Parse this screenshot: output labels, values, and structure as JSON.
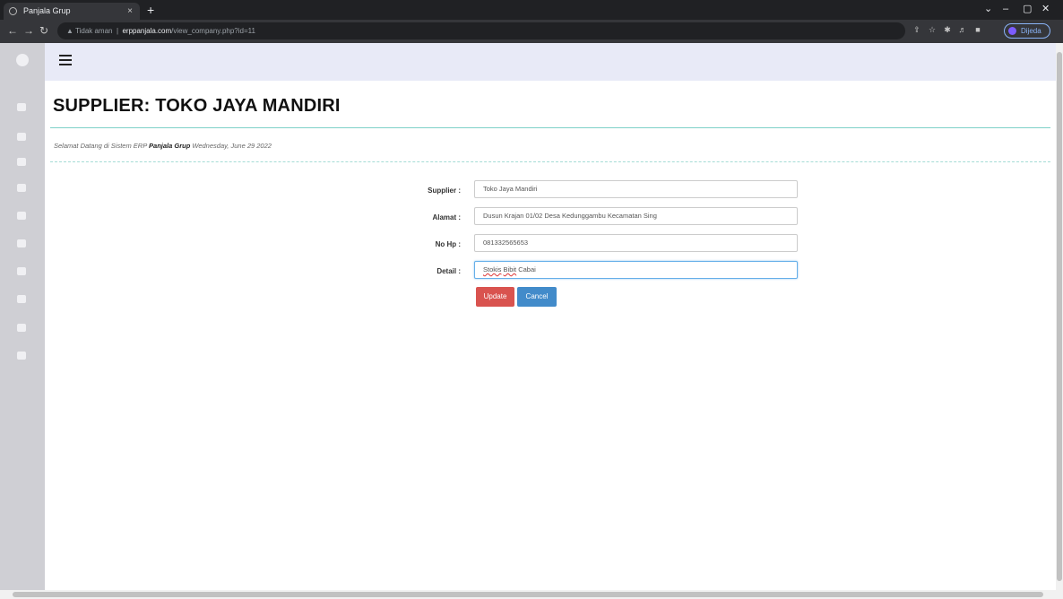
{
  "browser": {
    "tab_title": "Panjala Grup",
    "tab_close": "×",
    "new_tab": "+",
    "security": "▲ Tidak aman",
    "url_host": "erppanjala.com",
    "url_path": "/view_company.php?id=11",
    "profile_label": "Dijeda",
    "window_controls": [
      "⌄",
      "–",
      "▢",
      "✕"
    ]
  },
  "header": {
    "page_title": "SUPPLIER: TOKO JAYA MANDIRI",
    "welcome_prefix": "Selamat Datang di Sistem ERP",
    "welcome_brand": "Panjala Grup",
    "welcome_date": "Wednesday, June 29 2022"
  },
  "form": {
    "supplier_label": "Supplier :",
    "supplier_value": "Toko Jaya Mandiri",
    "alamat_label": "Alamat :",
    "alamat_value": "Dusun Krajan 01/02 Desa Kedunggambu Kecamatan Sing",
    "nohp_label": "No Hp :",
    "nohp_value": "081332565653",
    "detail_label": "Detail :",
    "detail_word1": "Stokis",
    "detail_word2": "Bibit",
    "detail_word3": "Cabai",
    "update_label": "Update",
    "cancel_label": "Cancel"
  },
  "colors": {
    "update_button": "#d9534f",
    "cancel_button": "#428bca",
    "topbar": "#e8eaf7",
    "sidebar": "#cfcfd4",
    "divider": "#7fd1c8"
  }
}
